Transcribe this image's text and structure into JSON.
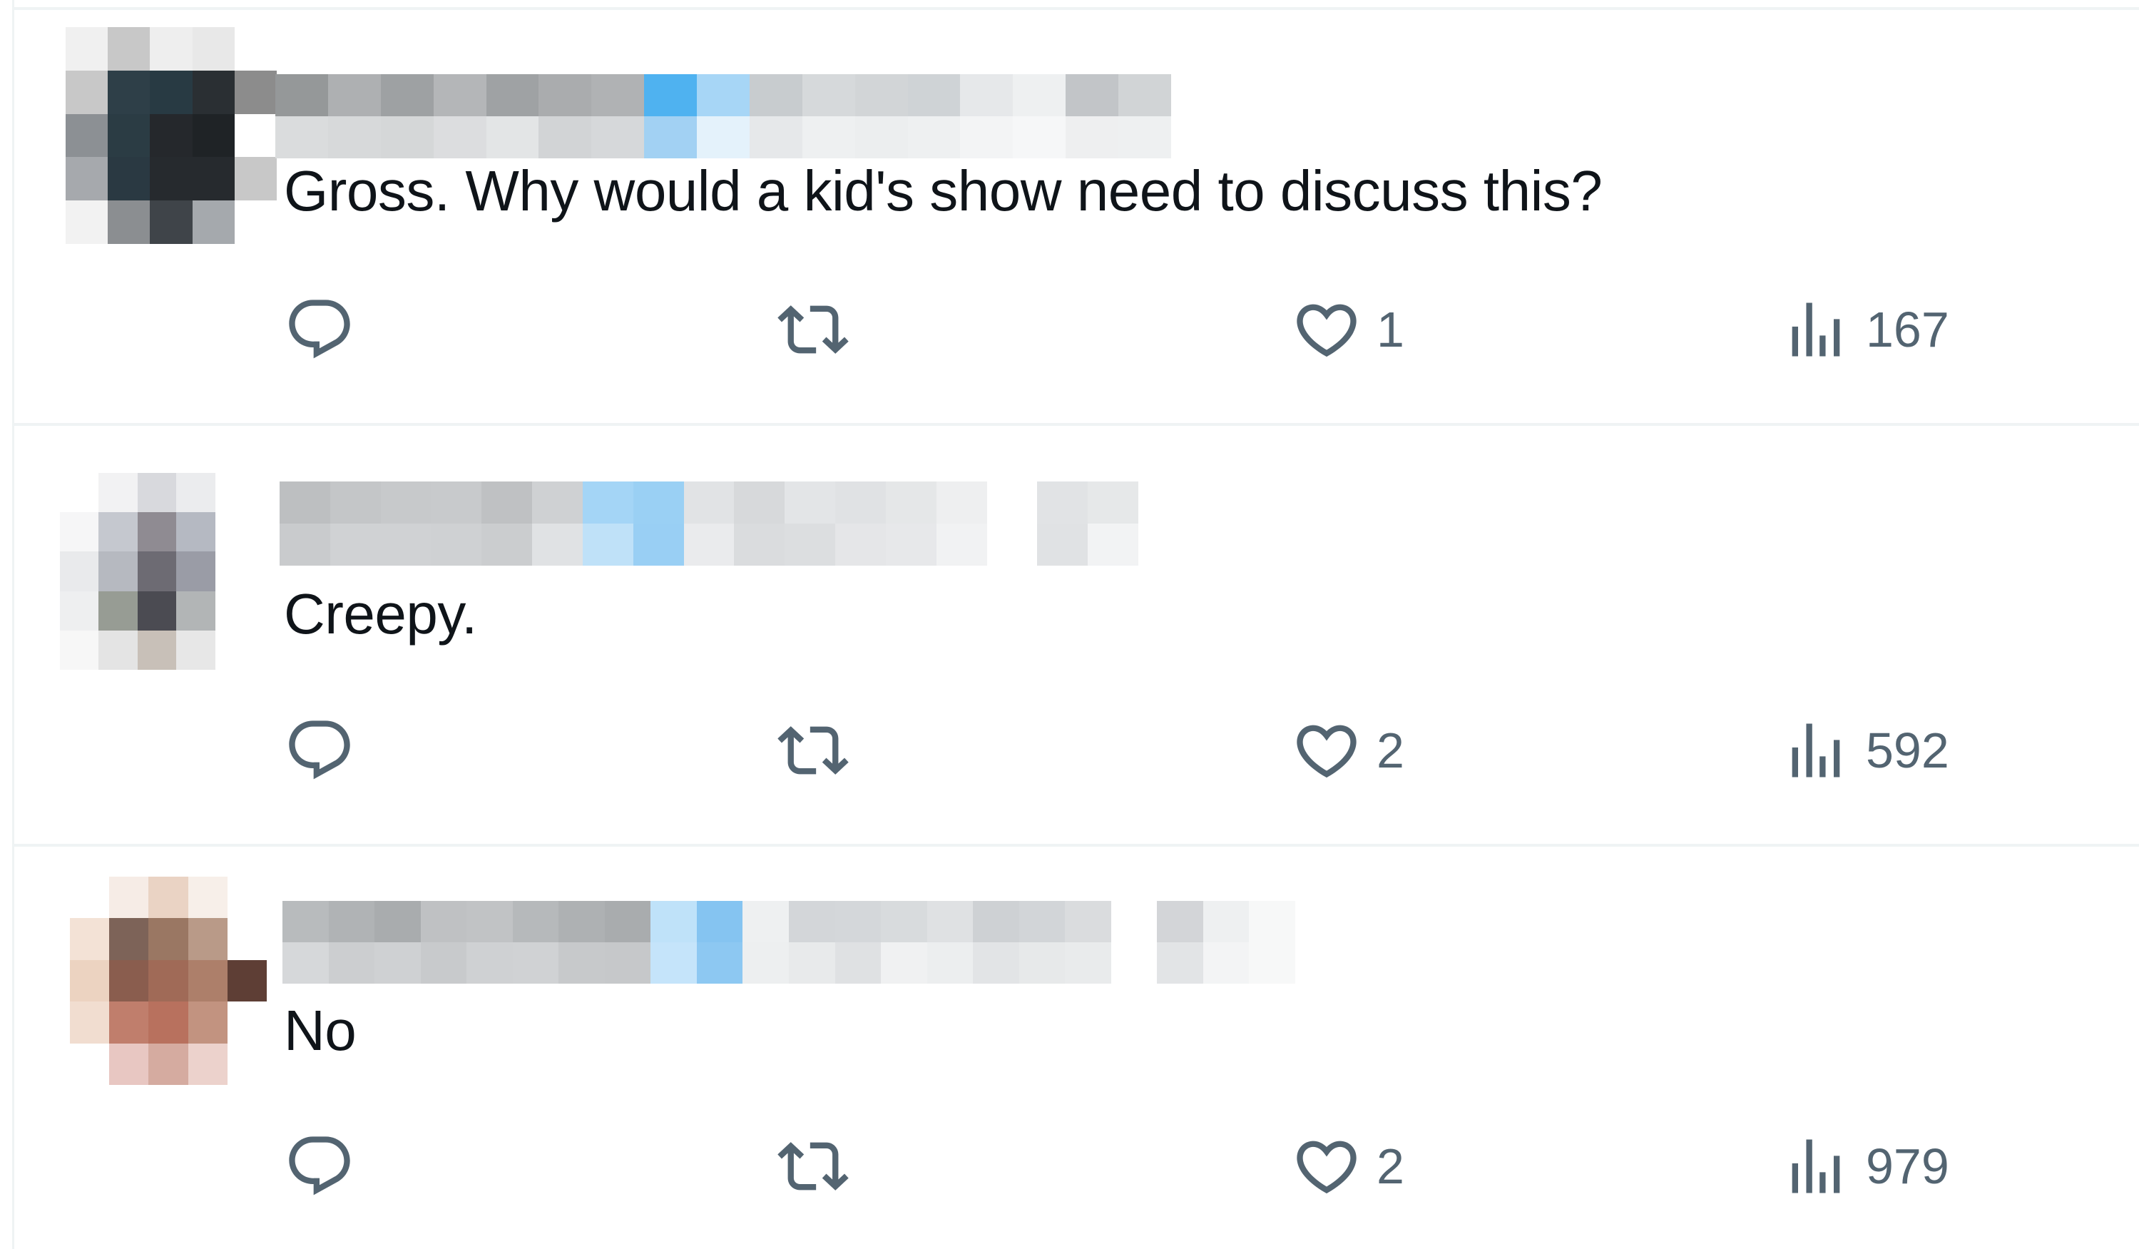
{
  "colors": {
    "text": "#0f1419",
    "muted": "#536471",
    "divider": "#eff3f4",
    "accent": "#1d9bf0"
  },
  "replies": [
    {
      "text": "Gross. Why would a kid's show need to discuss this?",
      "reply_count": "",
      "retweet_count": "",
      "like_count": "1",
      "view_count": "167",
      "avatar_colors": [
        "#f0f0f0",
        "#c8c8c8",
        "#eeeeee",
        "#e8e8e8",
        "#ffffff",
        "#c8c8c8",
        "#2e3f48",
        "#283a43",
        "#2a2f33",
        "#8c8c8c",
        "#8c9094",
        "#2b3c44",
        "#25282c",
        "#1f2326",
        "#ffffff",
        "#a6a9ad",
        "#2a3942",
        "#262a2e",
        "#262a2e",
        "#c8c8c8",
        "#f2f2f2",
        "#8b8e91",
        "#3f4449",
        "#a5a9ad",
        "#ffffff"
      ],
      "name_colors_top": [
        "#959899",
        "#aeb0b2",
        "#9ea1a3",
        "#b4b6b8",
        "#9fa2a4",
        "#aaacae",
        "#b0b2b4",
        "#4fb2f0",
        "#a7d6f6",
        "#c8cccf",
        "#d6d9db",
        "#d2d5d7",
        "#cfd3d6",
        "#e6e8ea",
        "#eef0f1",
        "#c2c5c8",
        "#d1d4d6"
      ],
      "name_colors_bottom": [
        "#dadcdd",
        "#d7d9da",
        "#d5d7d8",
        "#dcdddf",
        "#e3e5e6",
        "#d2d4d6",
        "#d6d8da",
        "#a2d1f3",
        "#e4f2fb",
        "#e6e8ea",
        "#eef0f1",
        "#eceeef",
        "#eef0f1",
        "#f3f4f5",
        "#f6f7f8",
        "#eeeff0",
        "#eef0f1"
      ]
    },
    {
      "text": "Creepy.",
      "reply_count": "",
      "retweet_count": "",
      "like_count": "2",
      "view_count": "592",
      "avatar_colors": [
        "#ffffff",
        "#f2f2f3",
        "#d8d9dd",
        "#ebecee",
        "#ffffff",
        "#f6f6f7",
        "#c5c8cf",
        "#8f8b92",
        "#b5b9c2",
        "#ffffff",
        "#e9eaec",
        "#b6b9c0",
        "#6d6b73",
        "#9a9ca6",
        "#ffffff",
        "#eeeff0",
        "#979c94",
        "#4b4b52",
        "#b2b5b6",
        "#ffffff",
        "#f7f7f7",
        "#e4e4e4",
        "#c8c0b8",
        "#e7e7e7",
        "#ffffff"
      ],
      "name_colors_top": [
        "#bdbfc1",
        "#c4c6c8",
        "#c7c9cb",
        "#c8cacc",
        "#bfc1c3",
        "#cfd1d3",
        "#a4d5f6",
        "#9ad0f4",
        "#e1e3e5",
        "#d7d9db",
        "#e3e5e7",
        "#e0e2e4",
        "#e5e7e8",
        "#eeeff0",
        "#ffffff",
        "#e1e3e5",
        "#e6e8e9"
      ],
      "name_colors_bottom": [
        "#c9cbcd",
        "#d0d2d4",
        "#d0d2d4",
        "#cfd1d3",
        "#cbcdcf",
        "#e0e2e4",
        "#bfe1f8",
        "#99cff4",
        "#eaebed",
        "#dadcde",
        "#dcdee0",
        "#e5e6e8",
        "#e7e8ea",
        "#f1f2f3",
        "#ffffff",
        "#e0e2e4",
        "#f2f3f4"
      ]
    },
    {
      "text": "No",
      "reply_count": "",
      "retweet_count": "",
      "like_count": "2",
      "view_count": "979",
      "avatar_colors": [
        "#ffffff",
        "#f6ece6",
        "#ead3c4",
        "#f7efe9",
        "#ffffff",
        "#f3e2d6",
        "#7d6358",
        "#9a7763",
        "#b99a88",
        "#ffffff",
        "#ecd3c1",
        "#8a5d4e",
        "#a06a57",
        "#ad7f6a",
        "#5e3e35",
        "#f1ddd0",
        "#c07e6c",
        "#b8715e",
        "#c29380",
        "#ffffff",
        "#ffffff",
        "#e8c7c2",
        "#d5aba0",
        "#ecd2cc",
        "#ffffff"
      ],
      "name_colors_top": [
        "#b8bbbd",
        "#b0b3b5",
        "#a9acae",
        "#bfc1c3",
        "#c1c3c5",
        "#b6b9bb",
        "#aeb1b3",
        "#a9acae",
        "#bfe2f9",
        "#85c4f1",
        "#eef0f1",
        "#d3d6d9",
        "#d4d7da",
        "#d8dbdd",
        "#dfe1e3",
        "#ced1d4",
        "#d2d5d8",
        "#dadcde",
        "#ffffff",
        "#d3d5d8",
        "#eef0f1",
        "#f7f8f8"
      ],
      "name_colors_bottom": [
        "#d6d8da",
        "#ccced0",
        "#cfd1d3",
        "#c8cacc",
        "#cfd1d3",
        "#d0d2d4",
        "#c7c9cb",
        "#c6c8ca",
        "#c5e4fa",
        "#8dc8f2",
        "#edeff0",
        "#e8eaeb",
        "#dfe1e3",
        "#f0f1f2",
        "#eceeef",
        "#e2e4e6",
        "#e7e9ea",
        "#e9ebec",
        "#ffffff",
        "#e2e4e6",
        "#f3f4f5",
        "#f7f8f8"
      ]
    }
  ]
}
